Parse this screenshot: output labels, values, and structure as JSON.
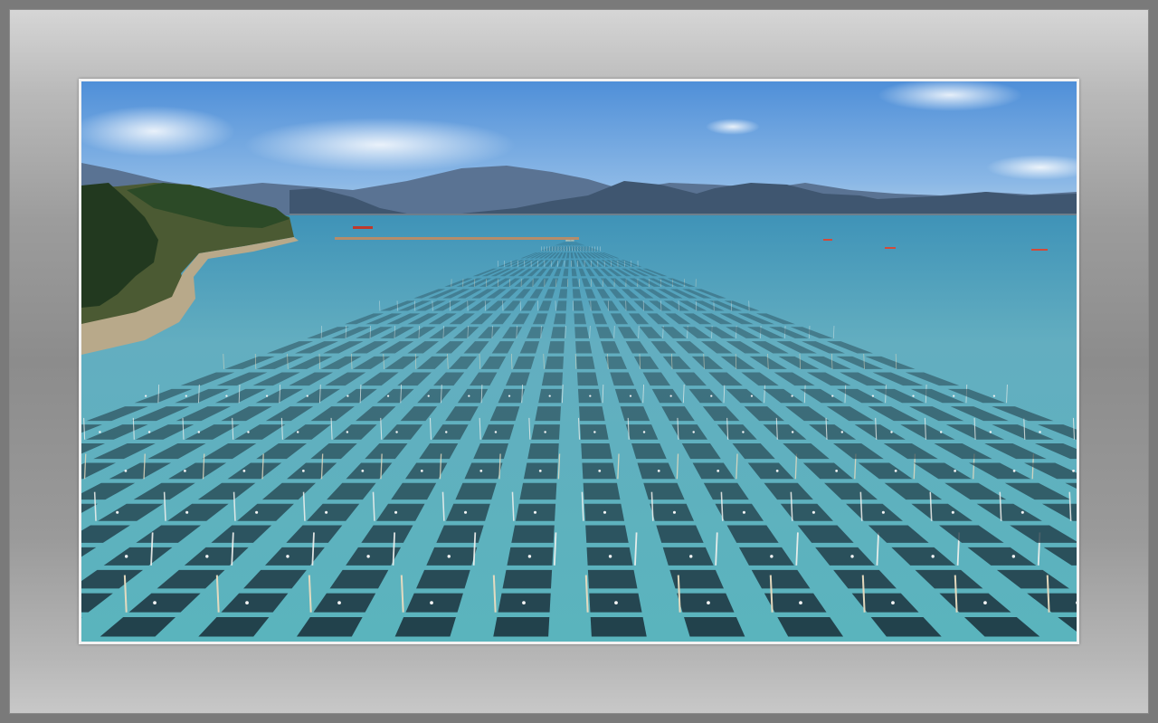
{
  "image": {
    "subject": "seaweed-farm-aerial-photo",
    "colors": {
      "sky": "#5f9fe0",
      "water": "#5fb3bd",
      "nets": "#1f3a45",
      "mountains": "#40566e",
      "frame": "#9c9c9c"
    }
  }
}
